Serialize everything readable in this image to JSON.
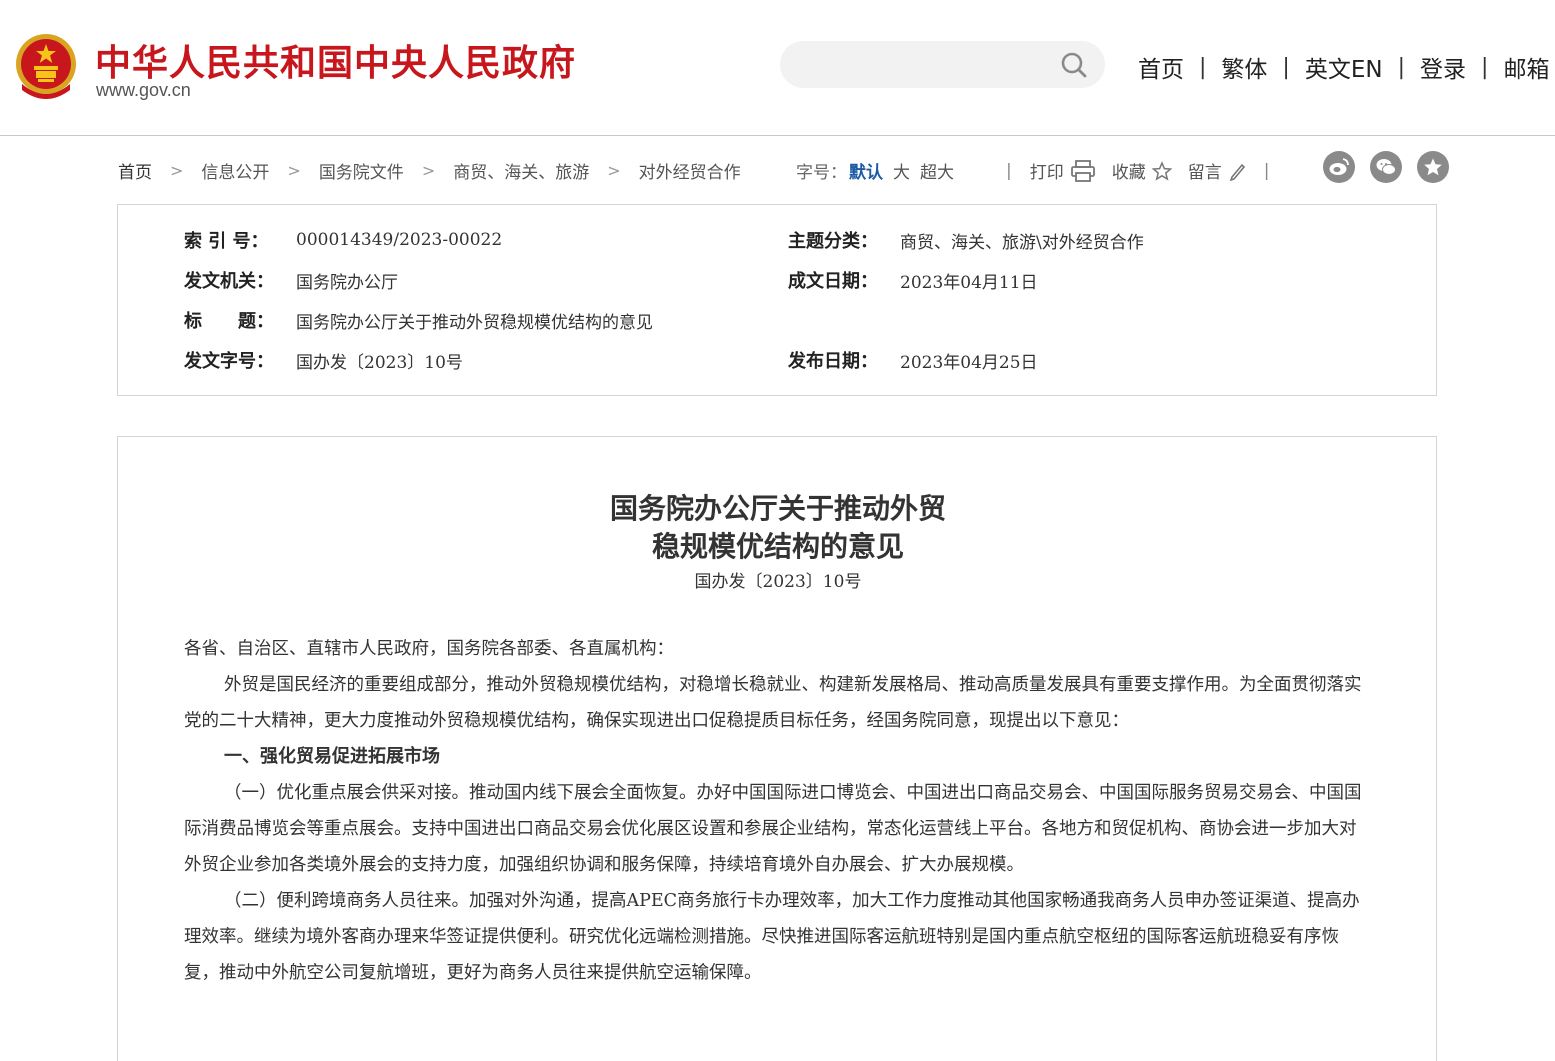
{
  "header": {
    "site_title": "中华人民共和国中央人民政府",
    "site_domain": "www.gov.cn",
    "search_placeholder": "",
    "nav": [
      "首页",
      "繁体",
      "英文EN",
      "登录",
      "邮箱"
    ],
    "brand_color": "#c8161d"
  },
  "breadcrumb": {
    "items": [
      "首页",
      "信息公开",
      "国务院文件",
      "商贸、海关、旅游",
      "对外经贸合作"
    ],
    "fontsize_label": "字号：",
    "fontsize_options": [
      "默认",
      "大",
      "超大"
    ],
    "print_label": "打印",
    "favorite_label": "收藏",
    "comment_label": "留言",
    "share_icons": [
      "weibo-icon",
      "wechat-icon",
      "star-icon"
    ]
  },
  "info": {
    "index_label": "索 引 号：",
    "index_value": "000014349/2023-00022",
    "topic_label": "主题分类：",
    "topic_value": "商贸、海关、旅游\\对外经贸合作",
    "issuer_label": "发文机关：",
    "issuer_value": "国务院办公厅",
    "written_date_label": "成文日期：",
    "written_date_value": "2023年04月11日",
    "title_label": "标　　题：",
    "title_value": "国务院办公厅关于推动外贸稳规模优结构的意见",
    "docno_label": "发文字号：",
    "docno_value": "国办发〔2023〕10号",
    "publish_date_label": "发布日期：",
    "publish_date_value": "2023年04月25日"
  },
  "article": {
    "title_line1": "国务院办公厅关于推动外贸",
    "title_line2": "稳规模优结构的意见",
    "docno": "国办发〔2023〕10号",
    "salutation": "各省、自治区、直辖市人民政府，国务院各部委、各直属机构：",
    "para1": "外贸是国民经济的重要组成部分，推动外贸稳规模优结构，对稳增长稳就业、构建新发展格局、推动高质量发展具有重要支撑作用。为全面贯彻落实党的二十大精神，更大力度推动外贸稳规模优结构，确保实现进出口促稳提质目标任务，经国务院同意，现提出以下意见：",
    "heading1": "一、强化贸易促进拓展市场",
    "para2": "（一）优化重点展会供采对接。推动国内线下展会全面恢复。办好中国国际进口博览会、中国进出口商品交易会、中国国际服务贸易交易会、中国国际消费品博览会等重点展会。支持中国进出口商品交易会优化展区设置和参展企业结构，常态化运营线上平台。各地方和贸促机构、商协会进一步加大对外贸企业参加各类境外展会的支持力度，加强组织协调和服务保障，持续培育境外自办展会、扩大办展规模。",
    "para3": "（二）便利跨境商务人员往来。加强对外沟通，提高APEC商务旅行卡办理效率，加大工作力度推动其他国家畅通我商务人员申办签证渠道、提高办理效率。继续为境外客商办理来华签证提供便利。研究优化远端检测措施。尽快推进国际客运航班特别是国内重点航空枢纽的国际客运航班稳妥有序恢复，推动中外航空公司复航增班，更好为商务人员往来提供航空运输保障。"
  }
}
